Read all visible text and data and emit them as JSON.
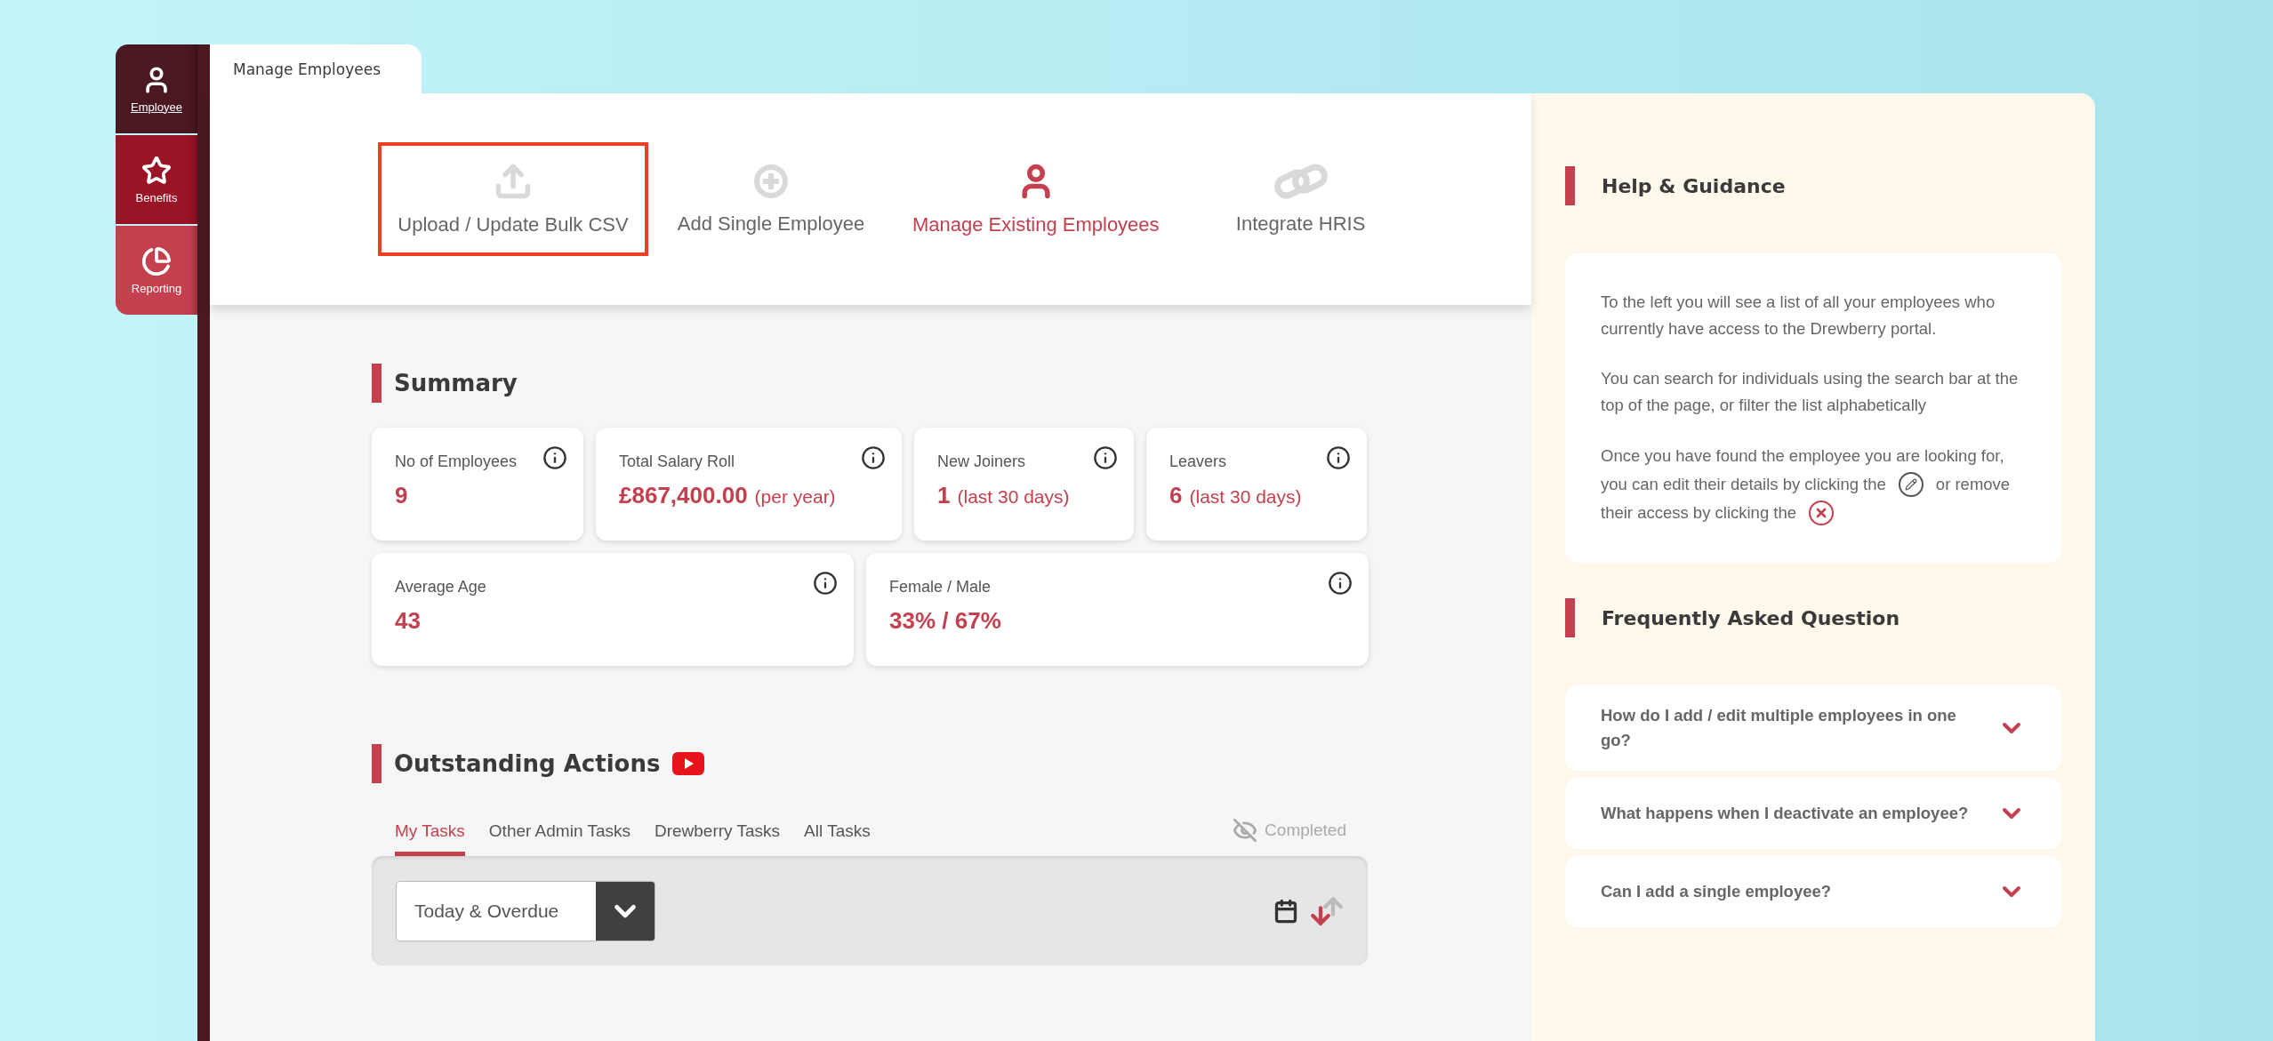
{
  "sidebar": {
    "items": [
      {
        "label": "Employee",
        "selected": true,
        "color": "#4a1820"
      },
      {
        "label": "Benefits",
        "selected": false,
        "color": "#9b1426"
      },
      {
        "label": "Reporting",
        "selected": false,
        "color": "#c4404f"
      }
    ]
  },
  "page_tab": {
    "label": "Manage Employees"
  },
  "nav_actions": [
    {
      "kind": "upload",
      "label": "Upload / Update Bulk CSV",
      "selected": false,
      "highlighted": true
    },
    {
      "kind": "add",
      "label": "Add Single Employee",
      "selected": false,
      "highlighted": false
    },
    {
      "kind": "manage",
      "label": "Manage Existing Employees",
      "selected": true,
      "highlighted": false
    },
    {
      "kind": "integrate",
      "label": "Integrate HRIS",
      "selected": false,
      "highlighted": false
    }
  ],
  "summary": {
    "title": "Summary",
    "rows": [
      [
        {
          "label": "No of Employees",
          "value": "9"
        },
        {
          "label": "Total Salary Roll",
          "value": "£867,400.00",
          "suffix": "(per year)"
        },
        {
          "label": "New Joiners",
          "value": "1",
          "suffix": "(last 30 days)"
        },
        {
          "label": "Leavers",
          "value": "6",
          "suffix": "(last 30 days)"
        }
      ],
      [
        {
          "label": "Average Age",
          "value": "43"
        },
        {
          "label": "Female / Male",
          "value": "33% / 67%"
        }
      ]
    ]
  },
  "outstanding_actions": {
    "title": "Outstanding Actions",
    "tabs": [
      {
        "label": "My Tasks",
        "selected": true
      },
      {
        "label": "Other Admin Tasks",
        "selected": false
      },
      {
        "label": "Drewberry Tasks",
        "selected": false
      },
      {
        "label": "All Tasks",
        "selected": false
      }
    ],
    "completed_toggle": {
      "label": "Completed"
    },
    "filter": {
      "value": "Today & Overdue"
    },
    "sort_descending": true
  },
  "help": {
    "title": "Help & Guidance",
    "paragraphs": [
      "To the left you will see a list of all your employees who currently have access to the Drewberry portal.",
      "You can search for individuals using the search bar at the top of the page, or filter the list alphabetically"
    ],
    "icon_paragraph": {
      "segments": [
        "Once you have found the employee you are looking for,",
        "you can edit their details by clicking the",
        "or remove",
        "their access by clicking the"
      ]
    }
  },
  "faq": {
    "title": "Frequently Asked Question",
    "items": [
      {
        "question": "How do I add / edit multiple employees in one go?",
        "expanded": false
      },
      {
        "question": "What happens when I deactivate an employee?",
        "expanded": false
      },
      {
        "question": "Can I add a single employee?",
        "expanded": false
      }
    ]
  }
}
